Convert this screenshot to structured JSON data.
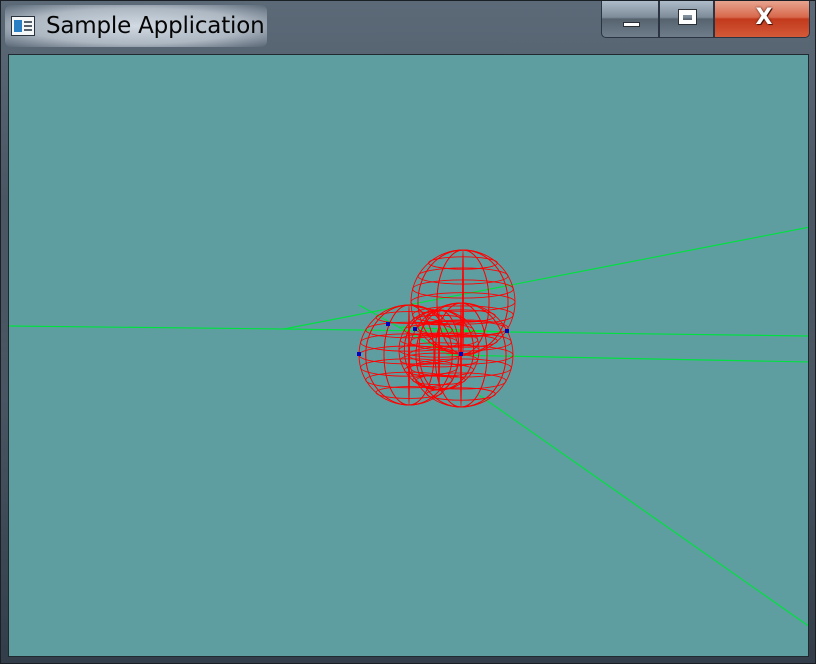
{
  "window": {
    "title": "Sample Application",
    "icon": "app-window-icon"
  },
  "titlebar_controls": {
    "minimize_icon": "minimize-icon",
    "maximize_icon": "maximize-icon",
    "close_icon": "close-icon",
    "close_glyph": "X"
  },
  "scene": {
    "background_color": "#5f9ea0",
    "sphere_wire_color": "#ff0000",
    "ray_color": "#00e040",
    "marker_color": "#0000c0",
    "sphere_count": 4
  }
}
